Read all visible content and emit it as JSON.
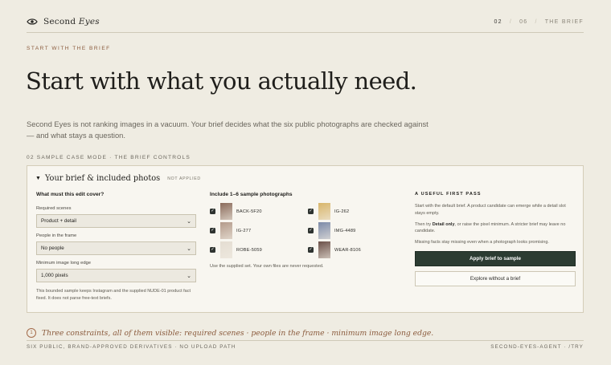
{
  "brand": {
    "name_plain": "Second",
    "name_italic": "Eyes",
    "icon": "eye-icon"
  },
  "pager": {
    "current": "02",
    "separator": "/",
    "total": "06",
    "label": "THE BRIEF"
  },
  "eyebrow": "START WITH THE BRIEF",
  "headline": "Start with what you actually need.",
  "lede": "Second Eyes is not ranking images in a vacuum. Your brief decides what the six public photographs are checked against — and what stays a question.",
  "section_label": "02  SAMPLE CASE MODE · THE BRIEF CONTROLS",
  "panel": {
    "title": "Your brief & included photos",
    "badge": "NOT APPLIED",
    "question": "What must this edit cover?",
    "fields": [
      {
        "label": "Required scenes",
        "value": "Product + detail"
      },
      {
        "label": "People in the frame",
        "value": "No people"
      },
      {
        "label": "Minimum image long edge",
        "value": "1,000 pixels"
      }
    ],
    "note": "This bounded sample keeps Instagram and the supplied NUDE-01 product fact fixed. It does not parse free-text briefs.",
    "photos_heading": "Include 1–6 sample photographs",
    "photos": [
      {
        "name": "BACK-5F20",
        "checked": true,
        "color": "#8a6a5a"
      },
      {
        "name": "IG-262",
        "checked": true,
        "color": "#d8b56a"
      },
      {
        "name": "IG-277",
        "checked": true,
        "color": "#b39a8a"
      },
      {
        "name": "IMG-4489",
        "checked": true,
        "color": "#7c8aa8"
      },
      {
        "name": "ROBE-5059",
        "checked": true,
        "color": "#e4ddd2"
      },
      {
        "name": "WEAR-8106",
        "checked": true,
        "color": "#6b5048"
      }
    ],
    "photos_foot": "Use the supplied set. Your own files are never requested.",
    "tip": {
      "heading": "A USEFUL FIRST PASS",
      "p1": "Start with the default brief. A product candidate can emerge while a detail slot stays empty.",
      "p2_pre": "Then try ",
      "p2_bold": "Detail only",
      "p2_post": ", or raise the pixel minimum. A stricter brief may leave no candidate.",
      "p3": "Missing facts stay missing even when a photograph looks promising.",
      "primary_button": "Apply brief to sample",
      "secondary_button": "Explore without a brief"
    }
  },
  "footnote": {
    "number": "1",
    "text": "Three constraints, all of them visible: required scenes · people in the frame · minimum image long edge."
  },
  "bottom": {
    "left": "SIX PUBLIC, BRAND-APPROVED DERIVATIVES · NO UPLOAD PATH",
    "right": "SECOND-EYES-AGENT · /TRY"
  },
  "colors": {
    "accent": "#8a5a3c",
    "primary_button": "#2c3c32",
    "background": "#efece2"
  }
}
